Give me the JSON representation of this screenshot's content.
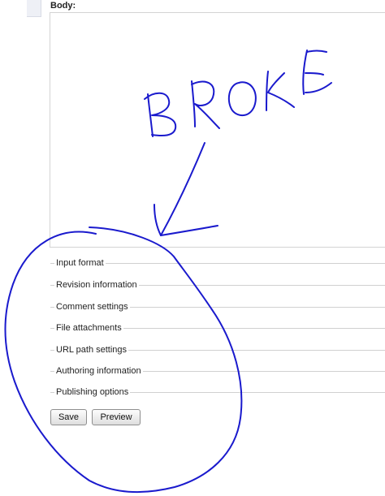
{
  "form": {
    "body_label": "Body:",
    "fieldsets": [
      {
        "label": "Input format"
      },
      {
        "label": "Revision information"
      },
      {
        "label": "Comment settings"
      },
      {
        "label": "File attachments"
      },
      {
        "label": "URL path settings"
      },
      {
        "label": "Authoring information"
      },
      {
        "label": "Publishing options"
      }
    ],
    "buttons": {
      "save": "Save",
      "preview": "Preview"
    }
  },
  "annotation": {
    "handwritten_text": "BROKE",
    "ink_color": "#1a1acd"
  }
}
